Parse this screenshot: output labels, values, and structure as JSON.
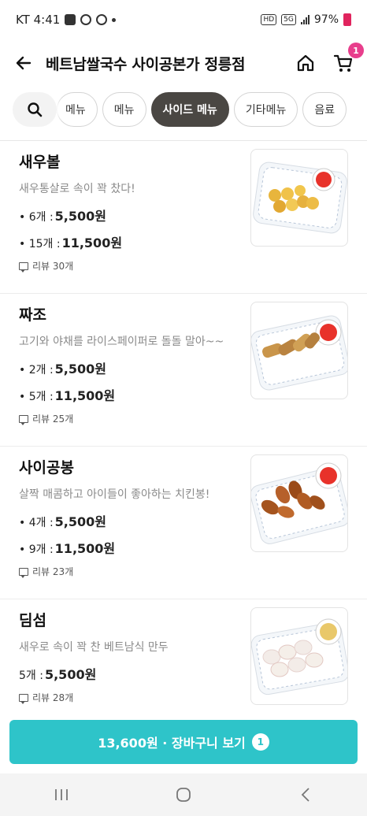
{
  "status_bar": {
    "carrier_time": "KT 4:41",
    "network": "5G",
    "hd": "HD",
    "battery": "97%"
  },
  "header": {
    "title": "베트남쌀국수 사이공본가 정릉점",
    "cart_count": "1"
  },
  "tabs": [
    {
      "label": "메뉴",
      "active": false
    },
    {
      "label": "메뉴",
      "active": false
    },
    {
      "label": "사이드 메뉴",
      "active": true
    },
    {
      "label": "기타메뉴",
      "active": false
    },
    {
      "label": "음료",
      "active": false
    }
  ],
  "menu_items": [
    {
      "name": "새우볼",
      "description": "새우통살로 속이 꽉 찼다!",
      "prices": [
        {
          "qty": "• 6개 : ",
          "price": "5,500원"
        },
        {
          "qty": "• 15개 : ",
          "price": "11,500원"
        }
      ],
      "review": "리뷰 30개"
    },
    {
      "name": "짜조",
      "description": "고기와 야채를 라이스페이퍼로 돌돌 말아~~",
      "prices": [
        {
          "qty": "• 2개 : ",
          "price": "5,500원"
        },
        {
          "qty": "• 5개 : ",
          "price": "11,500원"
        }
      ],
      "review": "리뷰 25개"
    },
    {
      "name": "사이공봉",
      "description": "살짝 매콤하고 아이들이 좋아하는 치킨봉!",
      "prices": [
        {
          "qty": "• 4개 : ",
          "price": "5,500원"
        },
        {
          "qty": "• 9개 : ",
          "price": "11,500원"
        }
      ],
      "review": "리뷰 23개"
    },
    {
      "name": "딤섬",
      "description": "새우로 속이 꽉 찬 베트남식 만두",
      "prices": [
        {
          "qty": "5개 : ",
          "price": "5,500원"
        }
      ],
      "review": "리뷰 28개"
    }
  ],
  "cart_bar": {
    "label": "13,600원 · 장바구니 보기",
    "count": "1"
  },
  "colors": {
    "accent": "#2ec4c9",
    "active_tab": "#4a4743",
    "badge": "#e83e8c"
  }
}
